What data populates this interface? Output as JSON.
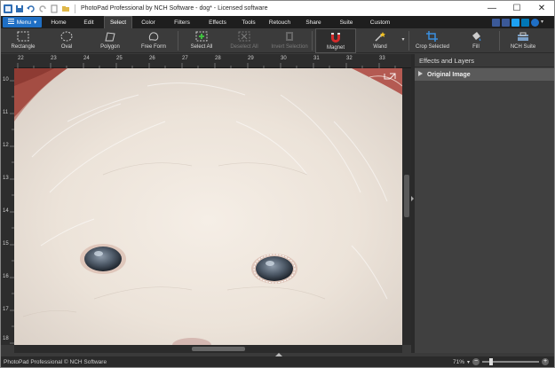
{
  "window": {
    "title": "PhotoPad Professional by NCH Software - dog* - Licensed software",
    "controls": {
      "minimize": "—",
      "maximize": "☐",
      "close": "✕"
    }
  },
  "menu_button": {
    "label": "Menu",
    "icon": "hamburger-icon"
  },
  "tabs": [
    {
      "label": "Home",
      "active": false
    },
    {
      "label": "Edit",
      "active": false
    },
    {
      "label": "Select",
      "active": true
    },
    {
      "label": "Color",
      "active": false
    },
    {
      "label": "Filters",
      "active": false
    },
    {
      "label": "Effects",
      "active": false
    },
    {
      "label": "Tools",
      "active": false
    },
    {
      "label": "Retouch",
      "active": false
    },
    {
      "label": "Share",
      "active": false
    },
    {
      "label": "Suite",
      "active": false
    },
    {
      "label": "Custom",
      "active": false
    }
  ],
  "toolbar": {
    "rectangle": "Rectangle",
    "oval": "Oval",
    "polygon": "Polygon",
    "free_form": "Free Form",
    "select_all": "Select All",
    "deselect_all": "Deselect All",
    "invert_selection": "Invert Selection",
    "magnet": "Magnet",
    "wand": "Wand",
    "crop_selected": "Crop Selected",
    "fill": "Fill",
    "nch_suite": "NCH Suite"
  },
  "ruler": {
    "h_labels": [
      "22",
      "23",
      "24",
      "25",
      "26",
      "27",
      "28",
      "29",
      "30",
      "31",
      "32",
      "33"
    ],
    "v_labels": [
      "10",
      "11",
      "12",
      "13",
      "14",
      "15",
      "16",
      "17",
      "18"
    ]
  },
  "panel": {
    "title": "Effects and Layers",
    "layer": "Original Image"
  },
  "status": {
    "text": "PhotoPad Professional © NCH Software",
    "zoom": "71%"
  },
  "colors": {
    "accent": "#1f6fc5",
    "dark_bg": "#3b3b3b",
    "panel_bg": "#404040"
  }
}
